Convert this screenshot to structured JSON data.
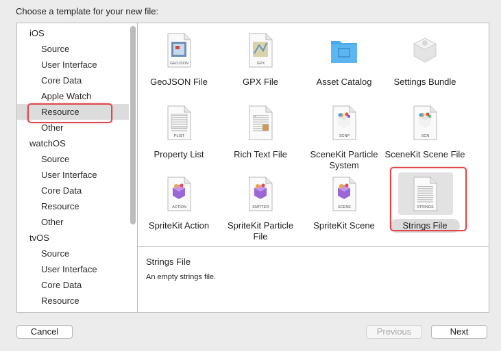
{
  "dialog": {
    "title": "Choose a template for your new file:"
  },
  "sidebar": {
    "items": [
      {
        "label": "iOS",
        "kind": "category"
      },
      {
        "label": "Source",
        "kind": "sub"
      },
      {
        "label": "User Interface",
        "kind": "sub"
      },
      {
        "label": "Core Data",
        "kind": "sub"
      },
      {
        "label": "Apple Watch",
        "kind": "sub"
      },
      {
        "label": "Resource",
        "kind": "sub",
        "selected": true
      },
      {
        "label": "Other",
        "kind": "sub"
      },
      {
        "label": "watchOS",
        "kind": "category"
      },
      {
        "label": "Source",
        "kind": "sub"
      },
      {
        "label": "User Interface",
        "kind": "sub"
      },
      {
        "label": "Core Data",
        "kind": "sub"
      },
      {
        "label": "Resource",
        "kind": "sub"
      },
      {
        "label": "Other",
        "kind": "sub"
      },
      {
        "label": "tvOS",
        "kind": "category"
      },
      {
        "label": "Source",
        "kind": "sub"
      },
      {
        "label": "User Interface",
        "kind": "sub"
      },
      {
        "label": "Core Data",
        "kind": "sub"
      },
      {
        "label": "Resource",
        "kind": "sub"
      }
    ]
  },
  "templates": [
    {
      "label": "GeoJSON File",
      "icon": "geojson-file-icon",
      "badge": "GEOJSON"
    },
    {
      "label": "GPX File",
      "icon": "gpx-file-icon",
      "badge": "GPX"
    },
    {
      "label": "Asset Catalog",
      "icon": "folder-icon",
      "badge": ""
    },
    {
      "label": "Settings Bundle",
      "icon": "settings-bundle-icon",
      "badge": ""
    },
    {
      "label": "Property List",
      "icon": "plist-file-icon",
      "badge": "PLIST"
    },
    {
      "label": "Rich Text File",
      "icon": "rich-text-file-icon",
      "badge": ""
    },
    {
      "label": "SceneKit Particle System",
      "icon": "scenekit-particle-icon",
      "badge": "SCNP"
    },
    {
      "label": "SceneKit Scene File",
      "icon": "scenekit-scene-icon",
      "badge": "SCN"
    },
    {
      "label": "SpriteKit Action",
      "icon": "spritekit-action-icon",
      "badge": "ACTION"
    },
    {
      "label": "SpriteKit Particle File",
      "icon": "spritekit-particle-icon",
      "badge": "EMITTER"
    },
    {
      "label": "SpriteKit Scene",
      "icon": "spritekit-scene-icon",
      "badge": "SCENE"
    },
    {
      "label": "Strings File",
      "icon": "strings-file-icon",
      "badge": "STRINGS",
      "selected": true
    }
  ],
  "detail": {
    "title": "Strings File",
    "description": "An empty strings file."
  },
  "buttons": {
    "cancel": "Cancel",
    "previous": "Previous",
    "next": "Next"
  },
  "colors": {
    "highlight": "#e0474c",
    "folder_blue": "#3ba0e8",
    "selection_gray": "#dcdcdc"
  }
}
